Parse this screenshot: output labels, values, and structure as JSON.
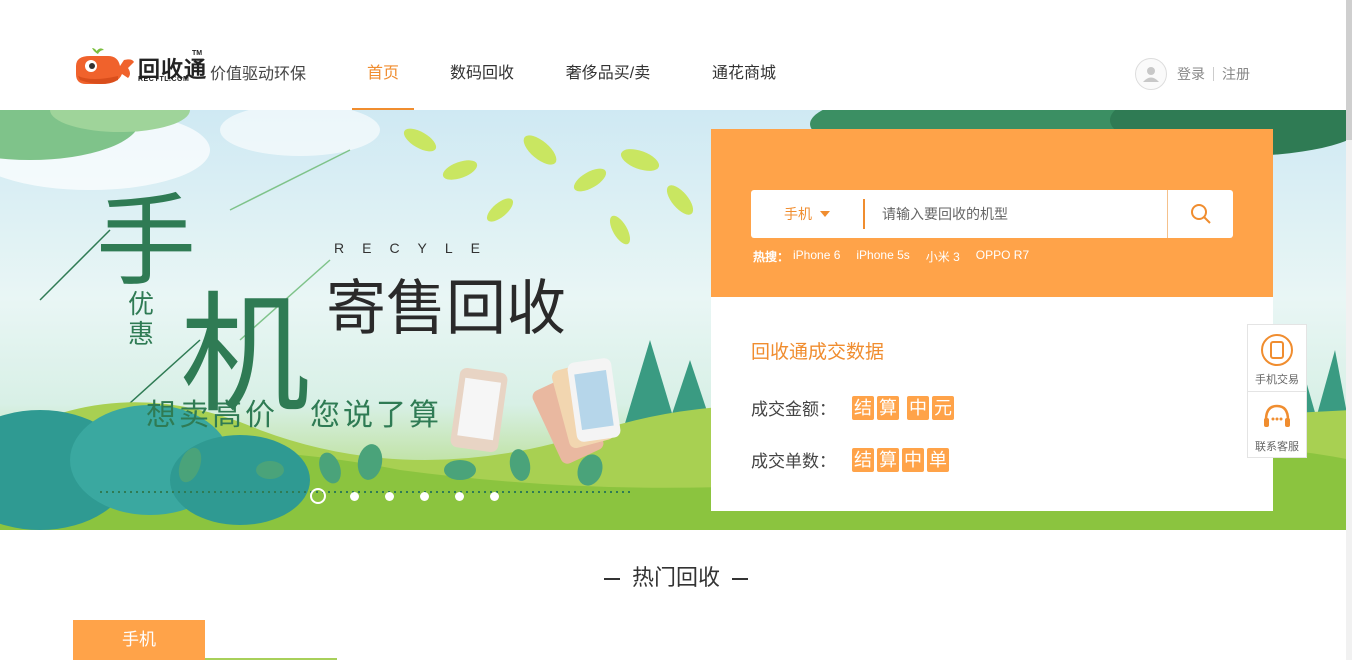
{
  "brand": {
    "logo_text": "回收通",
    "logo_sub": "RECYTL.COM",
    "logo_tm": "TM",
    "slogan": "价值驱动环保",
    "accent": "#f08d2f",
    "panel_orange": "#ffa349"
  },
  "nav": {
    "items": [
      {
        "label": "首页",
        "active": true
      },
      {
        "label": "数码回收",
        "active": false
      },
      {
        "label": "奢侈品买/卖",
        "active": false
      },
      {
        "label": "通花商城",
        "active": false
      }
    ]
  },
  "user": {
    "avatar_icon": "user-avatar-icon",
    "login": "登录",
    "register": "注册"
  },
  "banner": {
    "big_char_1": "手",
    "big_char_2": "机",
    "promo": "优惠",
    "recyle": "RECYLE",
    "headline": "寄售回收",
    "tagline_1": "想卖高价",
    "tagline_2": "您说了算",
    "slide_count": 6,
    "active_slide": 1
  },
  "search": {
    "category": "手机",
    "placeholder": "请输入要回收的机型",
    "search_icon": "search-icon",
    "hot_label": "热搜：",
    "hot_items": [
      "iPhone 6",
      "iPhone 5s",
      "小米 3",
      "OPPO R7"
    ]
  },
  "stats": {
    "title": "回收通成交数据",
    "amount_label": "成交金额：",
    "amount_chips": [
      "结",
      "算",
      "中",
      "元"
    ],
    "count_label": "成交单数：",
    "count_chips": [
      "结",
      "算",
      "中",
      "单"
    ]
  },
  "side": {
    "phone_trade": "手机交易",
    "phone_icon": "phone-icon",
    "support": "联系客服",
    "support_icon": "headset-icon"
  },
  "section": {
    "title": "热门回收",
    "tabs": [
      "手机"
    ]
  }
}
